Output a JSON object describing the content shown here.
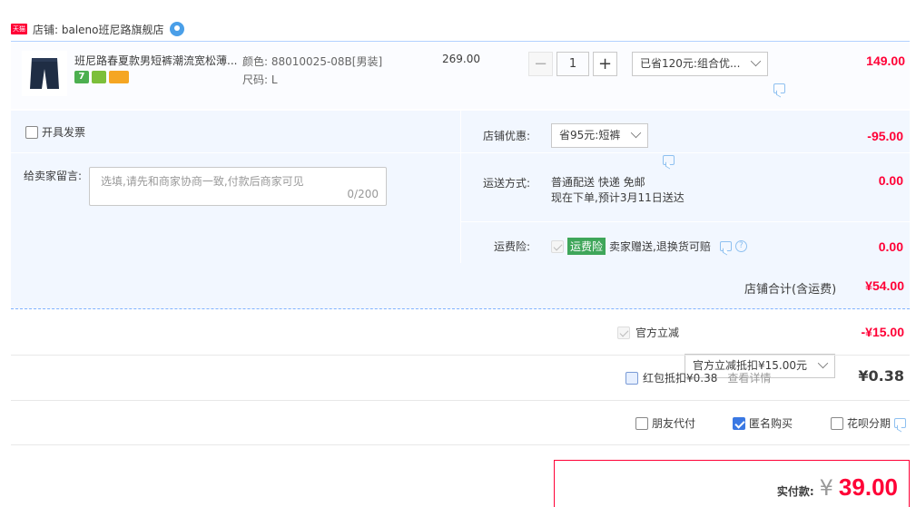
{
  "shop": {
    "badge": "天猫",
    "label": "店铺: baleno班尼路旗舰店"
  },
  "item": {
    "title": "班尼路春夏款男短裤潮流宽松薄...",
    "color_label": "颜色:",
    "color_value": "88010025-08B[男装]",
    "size_label": "尺码:",
    "size_value": "L",
    "unit_price": "269.00",
    "qty_minus": "−",
    "qty_value": "1",
    "qty_plus": "+",
    "promo_select": "已省120元:组合优...",
    "total": "149.00",
    "service_icons": [
      "seven-day-return-icon",
      "insurance-icon",
      "card-icon"
    ]
  },
  "invoice": {
    "label": "开具发票"
  },
  "message": {
    "label": "给卖家留言:",
    "placeholder": "选填,请先和商家协商一致,付款后商家可见",
    "counter": "0/200"
  },
  "shop_discount": {
    "label": "店铺优惠:",
    "select": "省95元:短裤",
    "amount": "-95.00"
  },
  "shipping": {
    "label": "运送方式:",
    "line1": "普通配送 快递 免邮",
    "line2": "现在下单,预计3月11日送达",
    "amount": "0.00"
  },
  "freight_ins": {
    "label": "运费险:",
    "tag": "运费险",
    "text": "卖家赠送,退换货可赔",
    "amount": "0.00"
  },
  "shop_total": {
    "label": "店铺合计(含运费)",
    "amount": "¥54.00"
  },
  "official": {
    "label": "官方立减",
    "select": "官方立减抵扣¥15.00元",
    "amount": "-¥15.00"
  },
  "redpacket": {
    "label": "红包抵扣¥0.38",
    "link": "查看详情",
    "amount": "¥0.38"
  },
  "options": {
    "friend_pay": "朋友代付",
    "anonymous": "匿名购买",
    "huabei": "花呗分期"
  },
  "pay": {
    "label": "实付款:",
    "currency": "¥",
    "amount": "39.00"
  },
  "colors": {
    "accent_red": "#ff0036",
    "blue_border": "#b2d1ff",
    "panel_bg": "#f2f7ff",
    "green_tag": "#3fa65a"
  }
}
